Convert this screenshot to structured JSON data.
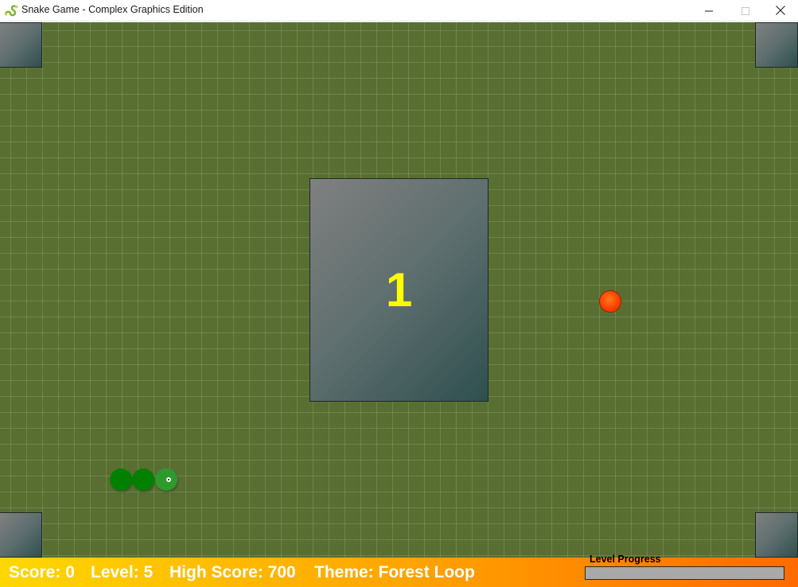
{
  "window": {
    "title": "Snake Game - Complex Graphics Edition",
    "icon": "snake-icon"
  },
  "controls": {
    "minimize_icon": "minimize-icon",
    "maximize_icon": "maximize-icon",
    "close_icon": "close-icon"
  },
  "game": {
    "countdown": "1",
    "theme_colors": {
      "field": "#596f32",
      "grid": "rgba(255,255,255,0.13)",
      "snake_body": "#008000",
      "snake_head": "#2e9a2e",
      "food": "#ff3b00",
      "obstacle_light": "#808080",
      "obstacle_dark": "#2f4f4f",
      "countdown_text": "#ffff00"
    },
    "snake_length": 3
  },
  "status": {
    "score": "Score: 0",
    "level": "Level: 5",
    "high_score": "High Score: 700",
    "theme": "Theme: Forest Loop",
    "progress_label": "Level Progress",
    "progress_value": 0,
    "gradient_colors": [
      "#ffd700",
      "#ffa500",
      "#ff6a00"
    ]
  }
}
